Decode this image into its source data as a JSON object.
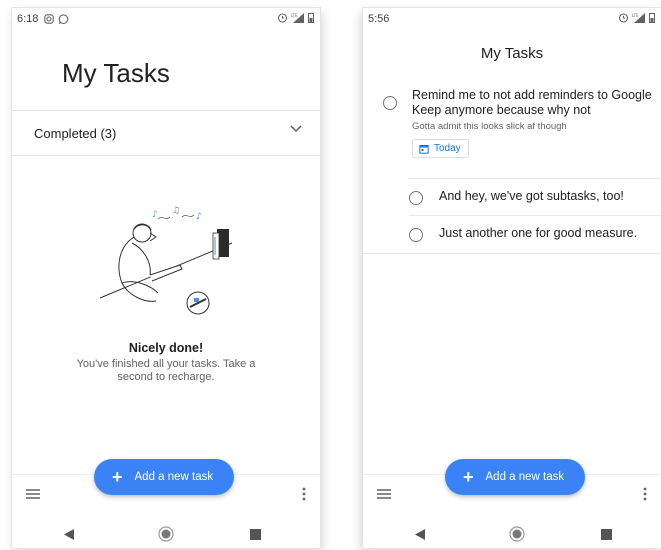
{
  "left_screen": {
    "status": {
      "time": "6:18"
    },
    "title": "My Tasks",
    "completed_label": "Completed (3)",
    "empty_title": "Nicely done!",
    "empty_message": "You've finished all your tasks. Take a second to recharge.",
    "fab_label": "Add a new task",
    "fab_icon": "plus-icon",
    "menu_icon": "menu-icon",
    "more_icon": "more-vert-icon"
  },
  "right_screen": {
    "status": {
      "time": "5:56"
    },
    "title": "My Tasks",
    "tasks": [
      {
        "title": "Remind me to not add reminders to Google Keep anymore because why not",
        "note": "Gotta admit this looks slick af though",
        "date_chip": "Today",
        "subtasks": [
          {
            "title": "And hey, we've got subtasks, too!"
          },
          {
            "title": "Just another one for good measure."
          }
        ]
      }
    ],
    "fab_label": "Add a new task"
  },
  "colors": {
    "accent": "#3b82f6",
    "chip_text": "#1a73e8",
    "text_primary": "#202124",
    "text_secondary": "#5f6368"
  }
}
